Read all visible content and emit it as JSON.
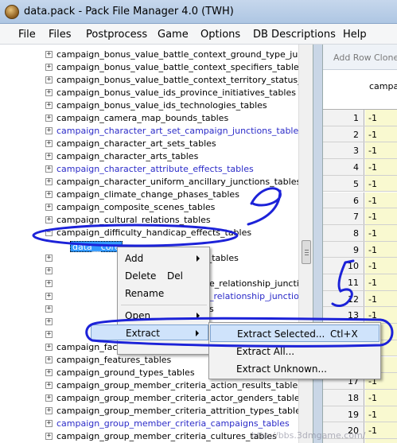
{
  "window": {
    "title": "data.pack - Pack File Manager 4.0 (TWH)"
  },
  "menubar": [
    "File",
    "Files",
    "Postprocess",
    "Game",
    "Options",
    "DB Descriptions",
    "Help"
  ],
  "tree": {
    "rows": [
      {
        "label": "campaign_bonus_value_battle_context_ground_type_junctions_",
        "expander": "+",
        "blue": false
      },
      {
        "label": "campaign_bonus_value_battle_context_specifiers_tables",
        "expander": "+",
        "blue": false
      },
      {
        "label": "campaign_bonus_value_battle_context_territory_status_junctions",
        "expander": "+",
        "blue": false
      },
      {
        "label": "campaign_bonus_value_ids_province_initiatives_tables",
        "expander": "+",
        "blue": false
      },
      {
        "label": "campaign_bonus_value_ids_technologies_tables",
        "expander": "+",
        "blue": false
      },
      {
        "label": "campaign_camera_map_bounds_tables",
        "expander": "+",
        "blue": false
      },
      {
        "label": "campaign_character_art_set_campaign_junctions_tables",
        "expander": "+",
        "blue": true
      },
      {
        "label": "campaign_character_art_sets_tables",
        "expander": "+",
        "blue": false
      },
      {
        "label": "campaign_character_arts_tables",
        "expander": "+",
        "blue": false
      },
      {
        "label": "campaign_character_attribute_effects_tables",
        "expander": "+",
        "blue": true
      },
      {
        "label": "campaign_character_uniform_ancillary_junctions_tables",
        "expander": "+",
        "blue": false
      },
      {
        "label": "campaign_climate_change_phases_tables",
        "expander": "+",
        "blue": false
      },
      {
        "label": "campaign_composite_scenes_tables",
        "expander": "+",
        "blue": false
      },
      {
        "label": "campaign_cultural_relations_tables",
        "expander": "+",
        "blue": false
      },
      {
        "label": "campaign_difficulty_handicap_effects_tables",
        "expander": "−",
        "blue": false
      },
      {
        "label": "",
        "expander": "",
        "blue": false
      },
      {
        "label": "s_tables",
        "expander": "+",
        "blue": false
      },
      {
        "label": "",
        "expander": "+",
        "blue": false
      },
      {
        "label": "e_relationship_junctions_",
        "expander": "+",
        "blue": false
      },
      {
        "label": "_relationship_junctions_ta",
        "expander": "+",
        "blue": true
      },
      {
        "label": "s",
        "expander": "+",
        "blue": false
      },
      {
        "label": "",
        "expander": "+",
        "blue": false
      },
      {
        "label": "",
        "expander": "+",
        "blue": false
      },
      {
        "label": "campaign_faction_religion_effects_tables",
        "expander": "+",
        "blue": false
      },
      {
        "label": "campaign_features_tables",
        "expander": "+",
        "blue": false
      },
      {
        "label": "campaign_ground_types_tables",
        "expander": "+",
        "blue": false
      },
      {
        "label": "campaign_group_member_criteria_action_results_tables",
        "expander": "+",
        "blue": false
      },
      {
        "label": "campaign_group_member_criteria_actor_genders_tables",
        "expander": "+",
        "blue": false
      },
      {
        "label": "campaign_group_member_criteria_attrition_types_tables",
        "expander": "+",
        "blue": false
      },
      {
        "label": "campaign_group_member_criteria_campaigns_tables",
        "expander": "+",
        "blue": true
      },
      {
        "label": "campaign_group_member_criteria_cultures_tables",
        "expander": "+",
        "blue": false
      }
    ],
    "selected_child": "data__core"
  },
  "grid": {
    "toolbar": {
      "add_row": "Add Row",
      "clone": "Clone"
    },
    "column_header": "campai",
    "rows": [
      {
        "num": "1",
        "value": "-1"
      },
      {
        "num": "2",
        "value": "-1"
      },
      {
        "num": "3",
        "value": "-1"
      },
      {
        "num": "4",
        "value": "-1"
      },
      {
        "num": "5",
        "value": "-1"
      },
      {
        "num": "6",
        "value": "-1"
      },
      {
        "num": "7",
        "value": "-1"
      },
      {
        "num": "8",
        "value": "-1"
      },
      {
        "num": "9",
        "value": "-1"
      },
      {
        "num": "10",
        "value": "-1"
      },
      {
        "num": "11",
        "value": "-1"
      },
      {
        "num": "12",
        "value": "-1"
      },
      {
        "num": "13",
        "value": "-1"
      },
      {
        "num": "14",
        "value": "-1"
      },
      {
        "num": "15",
        "value": "-1"
      },
      {
        "num": "16",
        "value": "-1"
      },
      {
        "num": "17",
        "value": "-1"
      },
      {
        "num": "18",
        "value": "-1"
      },
      {
        "num": "19",
        "value": "-1"
      },
      {
        "num": "20",
        "value": "-1"
      },
      {
        "num": "21",
        "value": "-1"
      }
    ]
  },
  "context_menu": {
    "add": "Add",
    "delete": "Delete",
    "delete_shortcut": "Del",
    "rename": "Rename",
    "open": "Open",
    "extract": "Extract"
  },
  "extract_submenu": {
    "selected": "Extract Selected...",
    "selected_shortcut": "Ctl+X",
    "all": "Extract All...",
    "unknown": "Extract Unknown..."
  },
  "watermark": "http://bbs.3dmgame.com/",
  "colors": {
    "annotation": "#1c22d8",
    "selection": "#3399ff",
    "hover_fill": "#cfe3fb",
    "cell_fill": "#f9f9d0"
  }
}
